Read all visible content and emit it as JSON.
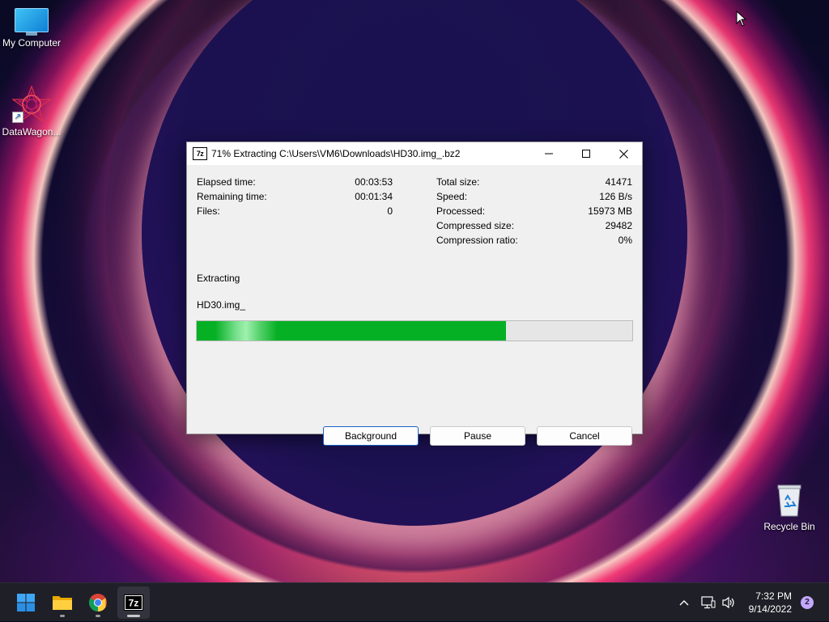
{
  "desktop": {
    "icons": [
      {
        "label": "My Computer",
        "icon": "monitor-icon"
      },
      {
        "label": "DataWagon...",
        "icon": "datawagon-star-icon"
      },
      {
        "label": "Recycle Bin",
        "icon": "recycle-bin-icon"
      }
    ]
  },
  "dialog": {
    "app_icon_text": "7z",
    "title": "71% Extracting C:\\Users\\VM6\\Downloads\\HD30.img_.bz2",
    "window_controls": [
      "minimize-icon",
      "maximize-icon",
      "close-icon"
    ],
    "stats_left": [
      {
        "label": "Elapsed time:",
        "value": "00:03:53"
      },
      {
        "label": "Remaining time:",
        "value": "00:01:34"
      },
      {
        "label": "Files:",
        "value": "0"
      }
    ],
    "stats_right": [
      {
        "label": "Total size:",
        "value": "41471"
      },
      {
        "label": "Speed:",
        "value": "126 B/s"
      },
      {
        "label": "Processed:",
        "value": "15973 MB"
      },
      {
        "label": "Compressed size:",
        "value": "29482"
      },
      {
        "label": "Compression ratio:",
        "value": "0%"
      }
    ],
    "status": "Extracting",
    "current_file": "HD30.img_",
    "progress_fraction": 0.71,
    "progress_color": "#06b025",
    "buttons": {
      "background": "Background",
      "pause": "Pause",
      "cancel": "Cancel"
    }
  },
  "taskbar": {
    "apps": [
      "windows-start-icon",
      "file-explorer-icon",
      "chrome-icon",
      "7zip-icon"
    ],
    "active_app": "7zip-icon",
    "tray_icons": [
      "chevron-up-icon",
      "network-icon",
      "volume-icon"
    ],
    "time": "7:32 PM",
    "date": "9/14/2022",
    "notification_count": "2"
  }
}
